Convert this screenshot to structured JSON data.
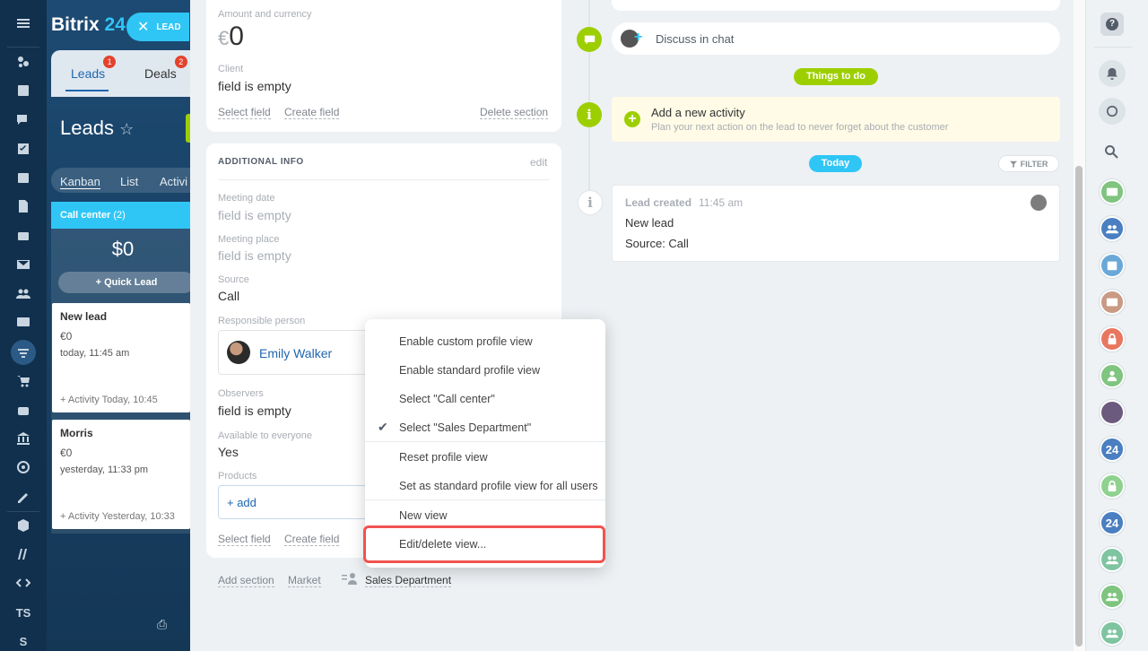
{
  "app": {
    "logo_text": "Bitrix",
    "logo_num": "24",
    "lead_chip": "LEAD"
  },
  "nav": {
    "icons": [
      "menu-icon",
      "gear-cluster-icon",
      "newsfeed-icon",
      "chat-icon",
      "tasks-icon",
      "calendar-icon",
      "docs-icon",
      "drive-icon",
      "mail-icon",
      "groups-icon",
      "crm-contact-icon",
      "crm-filter-icon",
      "shop-icon",
      "robot-icon",
      "bank-icon",
      "target-icon",
      "sign-icon",
      "box-icon",
      "marketplace-icon",
      "code-icon"
    ],
    "ts_label": "TS",
    "s_label": "S"
  },
  "kanban": {
    "tabs": [
      {
        "label": "Leads",
        "badge": "1"
      },
      {
        "label": "Deals",
        "badge": "2"
      }
    ],
    "title": "Leads",
    "view_tabs": [
      "Kanban",
      "List",
      "Activi"
    ],
    "column": {
      "name": "Call center",
      "count": "(2)",
      "sum": "$0",
      "quick_lead": "+ Quick Lead"
    },
    "cards": [
      {
        "name": "New lead",
        "amount": "€0",
        "date": "today, 11:45 am",
        "footer": "+ Activity    Today, 10:45"
      },
      {
        "name": "Morris",
        "amount": "€0",
        "date": "yesterday, 11:33 pm",
        "footer": "+ Activity Yesterday, 10:33"
      }
    ]
  },
  "form": {
    "amount_label": "Amount and currency",
    "amount_sym": "€",
    "amount_val": "0",
    "client_label": "Client",
    "client_val": "field is empty",
    "select_field": "Select field",
    "create_field": "Create field",
    "delete_section": "Delete section",
    "additional_title": "ADDITIONAL INFO",
    "edit": "edit",
    "meeting_date_label": "Meeting date",
    "meeting_date_val": "field is empty",
    "meeting_place_label": "Meeting place",
    "meeting_place_val": "field is empty",
    "source_label": "Source",
    "source_val": "Call",
    "responsible_label": "Responsible person",
    "responsible_name": "Emily Walker",
    "observers_label": "Observers",
    "observers_val": "field is empty",
    "available_label": "Available to everyone",
    "available_val": "Yes",
    "products_label": "Products",
    "add_product": "+ add",
    "select_field2": "Select field",
    "create_field2": "Create field",
    "add_section": "Add section",
    "market": "Market",
    "sales_department": "Sales Department"
  },
  "menu": {
    "items": [
      "Enable custom profile view",
      "Enable standard profile view",
      "Select \"Call center\"",
      "Select \"Sales Department\"",
      "Reset profile view",
      "Set as standard profile view for all users",
      "New view",
      "Edit/delete view..."
    ],
    "checked_index": 3,
    "highlighted_item": "Edit/delete view..."
  },
  "timeline": {
    "discuss": "Discuss in chat",
    "things_to_do": "Things to do",
    "add_activity_title": "Add a new activity",
    "add_activity_sub": "Plan your next action on the lead to never forget about the customer",
    "today": "Today",
    "filter": "FILTER",
    "event_title": "Lead created",
    "event_time": "11:45 am",
    "event_line1": "New lead",
    "event_line2": "Source: Call"
  },
  "rail": {
    "help": "?",
    "avatars": [
      {
        "icon": "contact-card-icon",
        "color": "#7fc47f"
      },
      {
        "icon": "group-icon",
        "color": "#4a7fc1"
      },
      {
        "icon": "calendar-icon",
        "color": "#6aa8d8"
      },
      {
        "icon": "contact-card-icon",
        "color": "#c99a84"
      },
      {
        "icon": "lock-icon",
        "color": "#e8775f"
      },
      {
        "icon": "user-icon",
        "color": "#7fc47f"
      },
      {
        "icon": "photo-icon",
        "color": "#6c5a7e"
      },
      {
        "label": "24",
        "color": "#4a7fc1"
      },
      {
        "icon": "lock-icon",
        "color": "#8fd18f"
      },
      {
        "label": "24",
        "color": "#4a7fc1"
      },
      {
        "icon": "group-icon",
        "color": "#7fc4a0"
      },
      {
        "icon": "group-icon",
        "color": "#7fc47f"
      },
      {
        "icon": "group-icon",
        "color": "#7fc4a0"
      }
    ]
  },
  "colors": {
    "accent": "#2fc6f6",
    "green": "#9dcf00",
    "danger": "#ef5350"
  }
}
